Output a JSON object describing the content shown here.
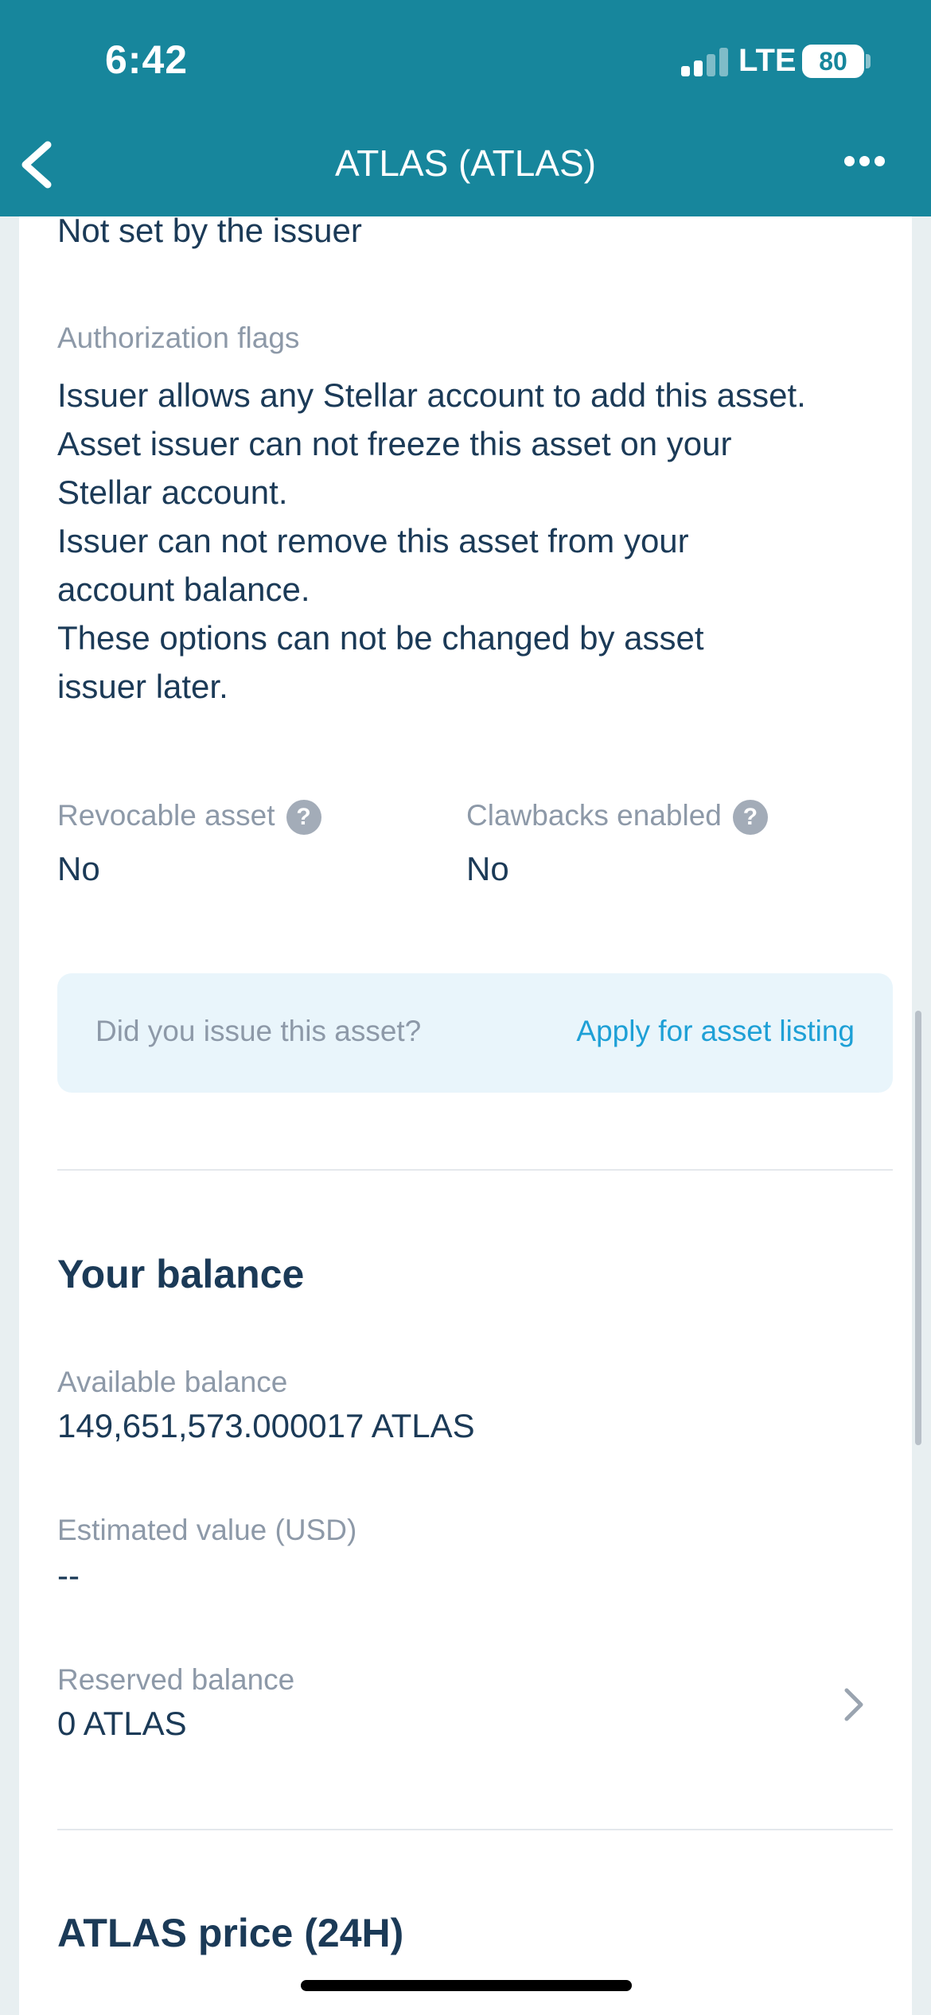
{
  "status_bar": {
    "time": "6:42",
    "network": "LTE",
    "battery": "80"
  },
  "nav": {
    "title": "ATLAS (ATLAS)",
    "back_icon": "chevron-left-icon",
    "more_icon": "more-horizontal-icon"
  },
  "details": {
    "top_value": "Not set by the issuer",
    "auth_flags_label": "Authorization flags",
    "auth_flags_lines": [
      "Issuer allows any Stellar account to add this asset.",
      "Asset issuer can not freeze this asset on your",
      "Stellar account.",
      "Issuer can not remove this asset from your",
      "account balance.",
      "These options can not be changed by asset",
      "issuer later."
    ],
    "revocable_label": "Revocable asset",
    "revocable_value": "No",
    "clawbacks_label": "Clawbacks enabled",
    "clawbacks_value": "No",
    "help_glyph": "?"
  },
  "listing_banner": {
    "question": "Did you issue this asset?",
    "link": "Apply for asset listing"
  },
  "balance": {
    "title": "Your balance",
    "available_label": "Available balance",
    "available_value": "149,651,573.000017 ATLAS",
    "estimated_label": "Estimated value (USD)",
    "estimated_value": "--",
    "reserved_label": "Reserved balance",
    "reserved_value": "0 ATLAS"
  },
  "price": {
    "title": "ATLAS price (24H)"
  },
  "colors": {
    "header": "#17869c",
    "link": "#1ea0d6",
    "text": "#1b3a57",
    "label": "#8d99a8"
  }
}
